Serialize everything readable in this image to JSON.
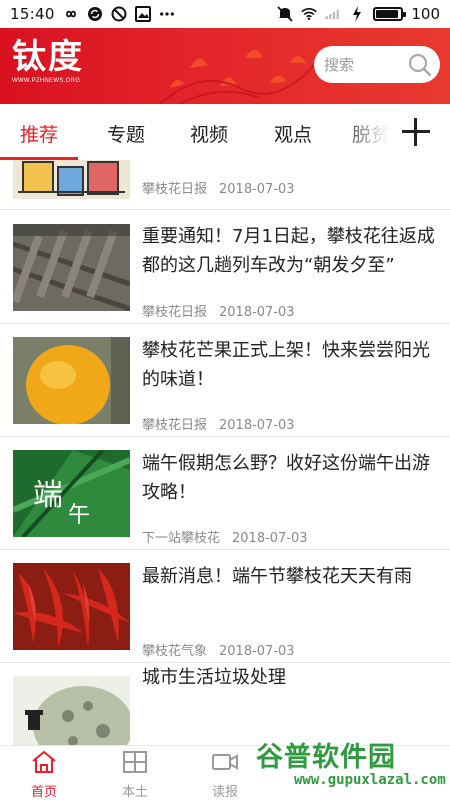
{
  "status_bar": {
    "time": "15:40",
    "battery": "100",
    "battery_level_percent": 100,
    "icons": [
      "infinity-icon",
      "sync-icon",
      "block-icon",
      "gallery-icon",
      "more-dots-icon",
      "mute-icon",
      "wifi-icon",
      "signal-icon",
      "charging-icon"
    ]
  },
  "header": {
    "logo": "钛度",
    "logo_sub": "WWW.PZHNEWS.ORG",
    "search_placeholder": "搜索",
    "colors": {
      "brand_red": "#e3232a",
      "accent_red": "#e8202a"
    }
  },
  "tabs": {
    "items": [
      {
        "label": "推荐",
        "active": true
      },
      {
        "label": "专题",
        "active": false
      },
      {
        "label": "视频",
        "active": false
      },
      {
        "label": "观点",
        "active": false
      },
      {
        "label": "脱贫",
        "active": false
      }
    ],
    "add_icon": "plus-icon"
  },
  "feed": {
    "items": [
      {
        "title": "",
        "source": "攀枝花日报",
        "date": "2018-07-03",
        "thumb": "illustration"
      },
      {
        "title": "重要通知！7月1日起，攀枝花往返成都的这几趟列车改为“朝发夕至”",
        "source": "攀枝花日报",
        "date": "2018-07-03",
        "thumb": "train-track"
      },
      {
        "title": "攀枝花芒果正式上架！快来尝尝阳光的味道！",
        "source": "攀枝花日报",
        "date": "2018-07-03",
        "thumb": "mango"
      },
      {
        "title": "端午假期怎么野？收好这份端午出游攻略！",
        "source": "下一站攀枝花",
        "date": "2018-07-03",
        "thumb": "dragon-boat-leaves"
      },
      {
        "title": "最新消息！端午节攀枝花天天有雨",
        "source": "攀枝花气象",
        "date": "2018-07-03",
        "thumb": "chili-peppers"
      },
      {
        "title": "城市生活垃圾处理",
        "source": "",
        "date": "",
        "thumb": "garbage-illustration"
      }
    ]
  },
  "bottom_nav": {
    "items": [
      {
        "label": "首页",
        "icon": "home-icon",
        "active": true
      },
      {
        "label": "本土",
        "icon": "map-icon",
        "active": false
      },
      {
        "label": "读报",
        "icon": "video-icon",
        "active": false
      }
    ]
  },
  "watermark": {
    "text": "谷普软件园",
    "url": "www.gupuxlazal.com"
  }
}
